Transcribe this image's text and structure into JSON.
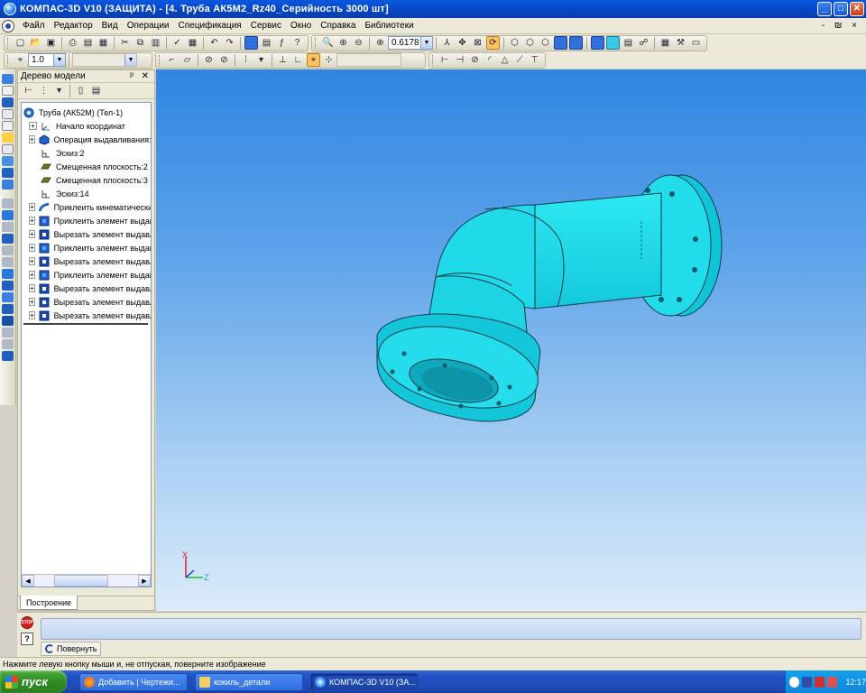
{
  "window": {
    "title": "КОМПАС-3D V10 (ЗАЩИТА) - [4. Труба АК5М2_Rz40_Серийность 3000 шт]",
    "minimize": "_",
    "maximize": "□",
    "close": "✕",
    "mdi_buttons": "- ₪ ×"
  },
  "menu": {
    "items": [
      "Файл",
      "Редактор",
      "Вид",
      "Операции",
      "Спецификация",
      "Сервис",
      "Окно",
      "Справка",
      "Библиотеки"
    ]
  },
  "toolbar": {
    "zoom_value": "0.6178",
    "step_value": "1.0"
  },
  "model_tree": {
    "panel_title": "Дерево модели",
    "panel_buttons": "ᵖ ✕",
    "root_label": "Труба (АК52М) (Тел-1)",
    "nodes": [
      {
        "label": "Начало координат",
        "expandable": true,
        "icon": "origin-icon"
      },
      {
        "label": "Операция выдавливания:",
        "expandable": true,
        "icon": "extrude-icon"
      },
      {
        "label": "Эскиз:2",
        "expandable": false,
        "icon": "sketch-icon"
      },
      {
        "label": "Смещенная плоскость:2",
        "expandable": false,
        "icon": "plane-icon"
      },
      {
        "label": "Смещенная плоскость:3",
        "expandable": false,
        "icon": "plane-icon"
      },
      {
        "label": "Эскиз:14",
        "expandable": false,
        "icon": "sketch-icon"
      },
      {
        "label": "Приклеить кинематически",
        "expandable": true,
        "icon": "sweep-icon"
      },
      {
        "label": "Приклеить элемент выдав",
        "expandable": true,
        "icon": "boss-icon"
      },
      {
        "label": "Вырезать элемент выдавл",
        "expandable": true,
        "icon": "cut-icon"
      },
      {
        "label": "Приклеить элемент выдав",
        "expandable": true,
        "icon": "boss-icon"
      },
      {
        "label": "Вырезать элемент выдавл",
        "expandable": true,
        "icon": "cut-icon"
      },
      {
        "label": "Приклеить элемент выдав",
        "expandable": true,
        "icon": "boss-icon"
      },
      {
        "label": "Вырезать элемент выдавл",
        "expandable": true,
        "icon": "cut-icon"
      },
      {
        "label": "Вырезать элемент выдавл",
        "expandable": true,
        "icon": "cut-icon"
      },
      {
        "label": "Вырезать элемент выдавл",
        "expandable": true,
        "icon": "cut-icon"
      }
    ],
    "tab_label": "Построение"
  },
  "viewport": {
    "axis_x": "X",
    "axis_z": "Z",
    "part_color": "#1ee6f0"
  },
  "params": {
    "rotate_label": "Повернуть",
    "stop_label": "STOP",
    "help_label": "?"
  },
  "status": {
    "text": "Нажмите левую кнопку мыши и, не отпуская, поверните изображение"
  },
  "taskbar": {
    "start_label": "пуск",
    "tasks": [
      {
        "label": "Добавить | Чертежи...",
        "active": false
      },
      {
        "label": "кокиль_детали",
        "active": false
      },
      {
        "label": "КОМПАС-3D V10 (ЗА...",
        "active": true
      }
    ],
    "clock": "12:17"
  }
}
